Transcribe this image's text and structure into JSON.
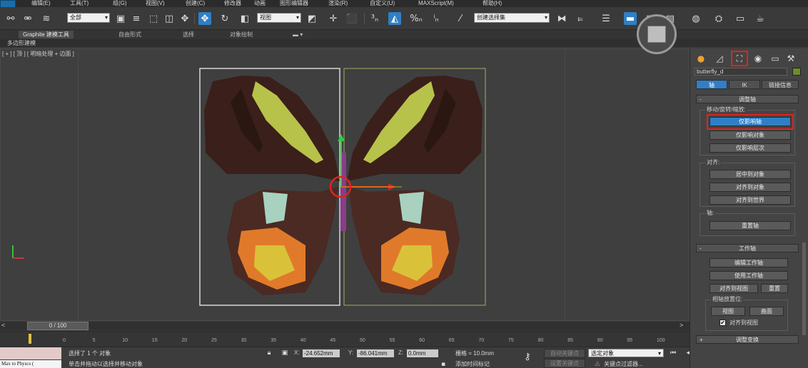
{
  "menu": {
    "items": [
      "编辑(E)",
      "工具(T)",
      "组(G)",
      "视图(V)",
      "创建(C)",
      "修改器",
      "动画",
      "图形编辑器",
      "渲染(R)",
      "自定义(U)",
      "MAXScript(M)",
      "帮助(H)"
    ]
  },
  "toolbar": {
    "selection_filter": "全部",
    "ref_coord": "视图",
    "named_selection": "创建选择集"
  },
  "ribbon": {
    "tabs": [
      "Graphite 建模工具",
      "自由形式",
      "选择",
      "对象绘制"
    ],
    "sub_label": "多边形建模"
  },
  "viewport": {
    "label": "[ + ] [ 顶 ] [ 明暗处理 + 边面 ]"
  },
  "timeline": {
    "frame_display": "0 / 100",
    "prev": "<",
    "next": ">",
    "ticks": [
      "0",
      "5",
      "10",
      "15",
      "20",
      "25",
      "30",
      "35",
      "40",
      "45",
      "50",
      "55",
      "60",
      "65",
      "70",
      "75",
      "80",
      "85",
      "90",
      "95",
      "100"
    ]
  },
  "status": {
    "maxscript_text": "Max to Physcs (",
    "selected_text": "选择了 1 个 对象",
    "hint_text": "单击并拖动以选择并移动对象",
    "x_label": "X:",
    "x_value": "-24.652mm",
    "y_label": "Y:",
    "y_value": "-86.041mm",
    "z_label": "Z:",
    "z_value": "0.0mm",
    "grid_text": "栅格 = 10.0mm",
    "add_time_tag": "添加时间标记",
    "auto_key": "自动关键点",
    "set_key": "设置关键点",
    "selection_set": "选定对象",
    "key_filters": "关键点过滤器..."
  },
  "command_panel": {
    "object_name": "butterfly_d",
    "object_color": "#6f8c27",
    "tabs": [
      "轴",
      "IK",
      "链接信息"
    ],
    "adjust_pivot": {
      "header": "调整轴",
      "move_label": "移动/旋转/缩放:",
      "buttons": [
        "仅影响轴",
        "仅影响对象",
        "仅影响层次"
      ],
      "align_label": "对齐:",
      "align_buttons": [
        "居中到对象",
        "对齐到对象",
        "对齐到世界"
      ],
      "pivot_label": "轴:",
      "reset_button": "重置轴"
    },
    "working_pivot": {
      "header": "工作轴",
      "buttons": [
        "编辑工作轴",
        "使用工作轴"
      ],
      "align_view": "对齐到视图",
      "reset": "重置",
      "placement_label": "相轴放置位:",
      "view_button": "视图",
      "surface_button": "曲面",
      "align_check": "对齐到视图"
    },
    "next_header": "调整变换"
  },
  "icons": {
    "colors": {
      "accent_blue": "#2f7fc6",
      "highlight_red": "#e02222"
    }
  }
}
